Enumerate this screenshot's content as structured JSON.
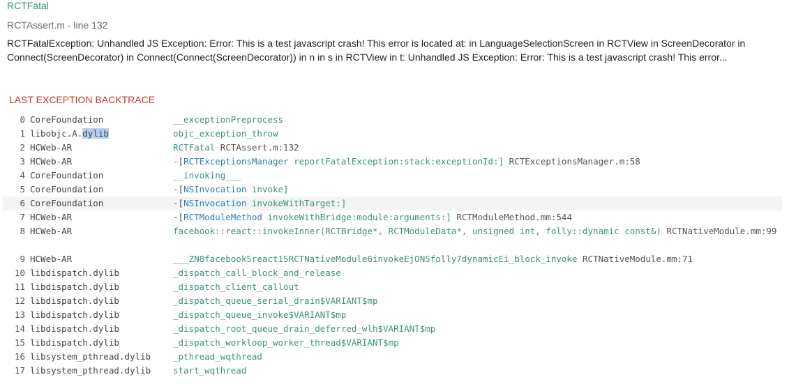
{
  "header": {
    "title": "RCTFatal",
    "subtitle": "RCTAssert.m - line 132",
    "message": "RCTFatalException: Unhandled JS Exception: Error: This is a test javascript crash! This error is located at: in LanguageSelectionScreen in RCTView in ScreenDecorator in Connect(ScreenDecorator) in Connect(Connect(ScreenDecorator)) in n in s in RCTView in t: Unhandled JS Exception: Error: This is a test javascript crash! This error..."
  },
  "backtrace": {
    "heading": "LAST EXCEPTION BACKTRACE",
    "frames": [
      {
        "index": "0",
        "library": "CoreFoundation",
        "symbol": "__exceptionPreprocess",
        "location": ""
      },
      {
        "index": "1",
        "library_pre": "libobjc.A.",
        "library_sel": "dylib",
        "symbol": "objc_exception_throw",
        "location": ""
      },
      {
        "index": "2",
        "library": "HCWeb-AR",
        "symbol": "RCTFatal",
        "location": "RCTAssert.m:132"
      },
      {
        "index": "3",
        "library": "HCWeb-AR",
        "prefix": "-[",
        "class": "RCTExceptionsManager",
        "method": " reportFatalException:stack:exceptionId:]",
        "location": "RCTExceptionsManager.m:58"
      },
      {
        "index": "4",
        "library": "CoreFoundation",
        "symbol": "__invoking___",
        "location": ""
      },
      {
        "index": "5",
        "library": "CoreFoundation",
        "prefix": "-[",
        "class": "NSInvocation",
        "method": " invoke]",
        "location": ""
      },
      {
        "index": "6",
        "library": "CoreFoundation",
        "prefix": "-[",
        "class": "NSInvocation",
        "method": " invokeWithTarget:]",
        "location": ""
      },
      {
        "index": "7",
        "library": "HCWeb-AR",
        "prefix": "-[",
        "class": "RCTModuleMethod",
        "method": " invokeWithBridge:module:arguments:]",
        "location": "RCTModuleMethod.mm:544"
      },
      {
        "index": "8",
        "library": "HCWeb-AR",
        "symbol": "facebook::react::invokeInner(RCTBridge*, RCTModuleData*, unsigned int, folly::dynamic const&)",
        "location": "RCTNativeModule.mm:99"
      },
      {
        "index": "9",
        "library": "HCWeb-AR",
        "symbol": "___ZN8facebook5react15RCTNativeModule6invokeEjON5folly7dynamicEi_block_invoke",
        "location": "RCTNativeModule.mm:71"
      },
      {
        "index": "10",
        "library": "libdispatch.dylib",
        "symbol": "_dispatch_call_block_and_release",
        "location": ""
      },
      {
        "index": "11",
        "library": "libdispatch.dylib",
        "symbol": "_dispatch_client_callout",
        "location": ""
      },
      {
        "index": "12",
        "library": "libdispatch.dylib",
        "symbol": "_dispatch_queue_serial_drain$VARIANT$mp",
        "location": ""
      },
      {
        "index": "13",
        "library": "libdispatch.dylib",
        "symbol": "_dispatch_queue_invoke$VARIANT$mp",
        "location": ""
      },
      {
        "index": "14",
        "library": "libdispatch.dylib",
        "symbol": "_dispatch_root_queue_drain_deferred_wlh$VARIANT$mp",
        "location": ""
      },
      {
        "index": "15",
        "library": "libdispatch.dylib",
        "symbol": "_dispatch_workloop_worker_thread$VARIANT$mp",
        "location": ""
      },
      {
        "index": "16",
        "library": "libsystem_pthread.dylib",
        "symbol": "_pthread_wqthread",
        "location": ""
      },
      {
        "index": "17",
        "library": "libsystem_pthread.dylib",
        "symbol": "start_wqthread",
        "location": ""
      }
    ]
  }
}
